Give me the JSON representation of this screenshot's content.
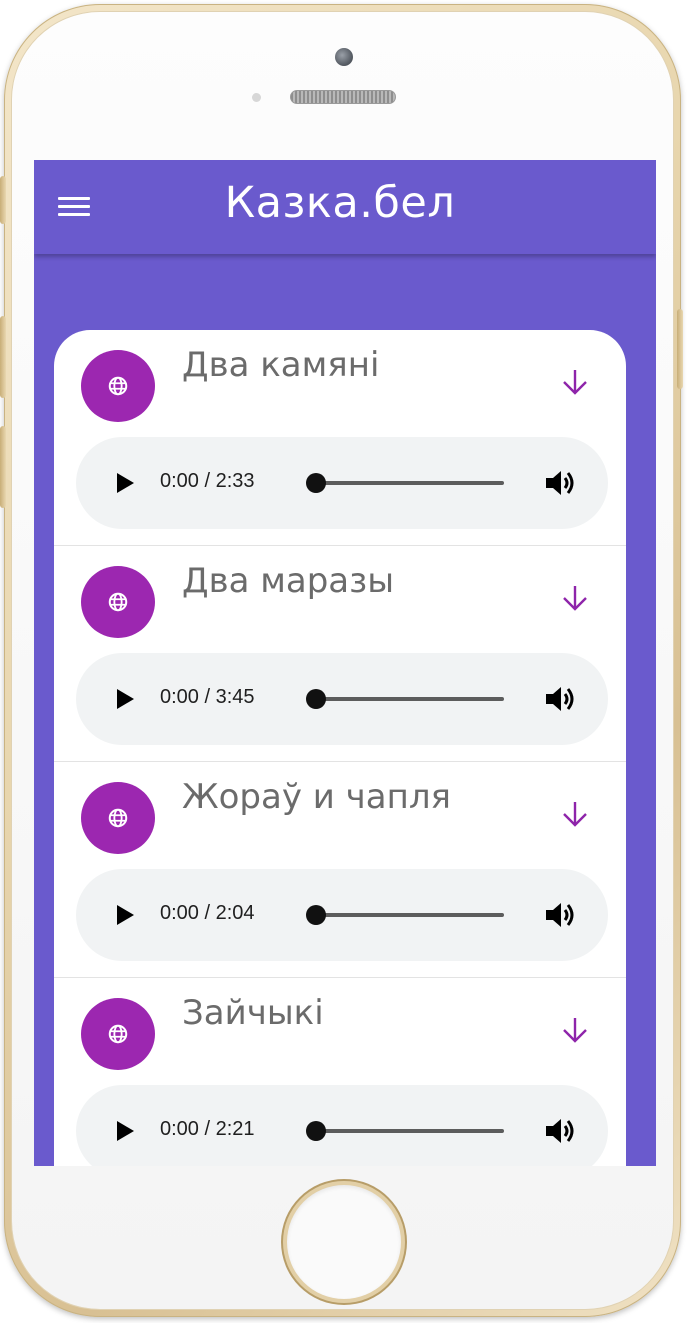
{
  "app": {
    "title": "Казка.бел",
    "accent_color": "#6a5acd",
    "badge_color": "#9c27b0",
    "menu_icon": "hamburger-menu-icon"
  },
  "stories": [
    {
      "title": "Два камяні",
      "time": "0:00 / 2:33",
      "progress": 0
    },
    {
      "title": "Два маразы",
      "time": "0:00 / 3:45",
      "progress": 0
    },
    {
      "title": "Жораў и чапля",
      "time": "0:00 / 2:04",
      "progress": 0
    },
    {
      "title": "Зайчыкі",
      "time": "0:00 / 2:21",
      "progress": 0
    }
  ],
  "icons": {
    "badge": "globe-icon",
    "download": "arrow-down-icon",
    "play": "play-icon",
    "volume": "volume-icon"
  }
}
